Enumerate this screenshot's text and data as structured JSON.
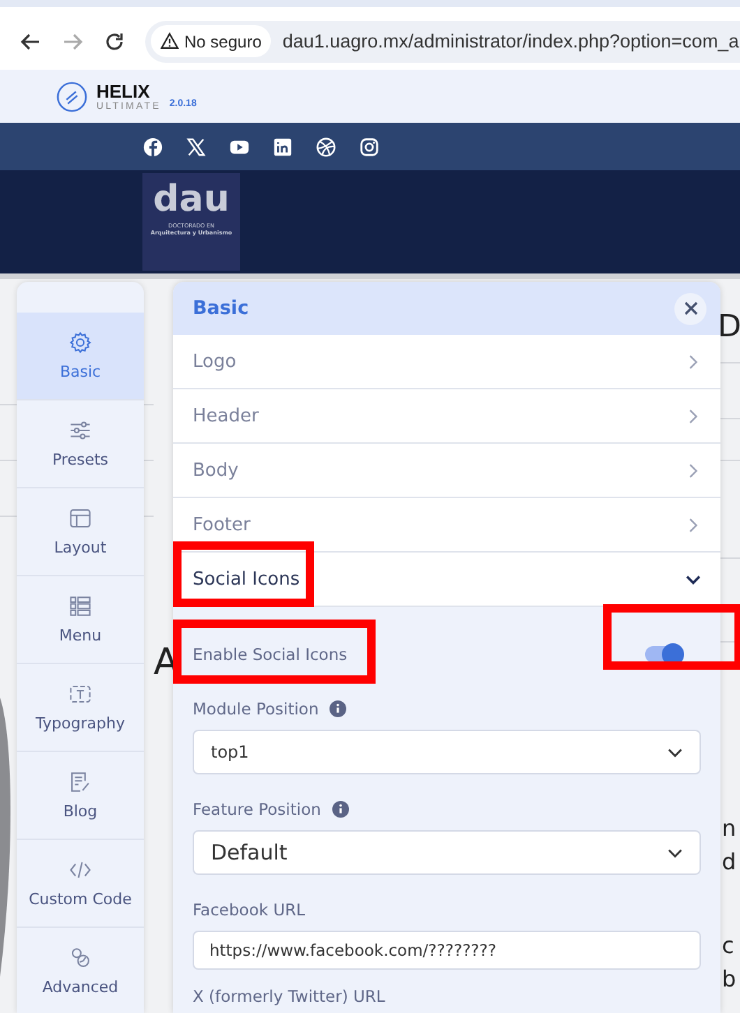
{
  "browser": {
    "security": "No seguro",
    "url": "dau1.uagro.mx/administrator/index.php?option=com_a"
  },
  "helix": {
    "name": "HELIX",
    "subtitle": "ULTIMATE",
    "version": "2.0.18"
  },
  "site_logo": {
    "wordmark": "dau",
    "line_1": "DOCTORADO EN",
    "line_2": "Arquitectura y Urbanismo"
  },
  "background_fragments": [
    "D",
    "A",
    "n",
    "d",
    "c",
    "b"
  ],
  "sidebar": {
    "items": [
      {
        "label": "Basic",
        "kind": "gear",
        "selected": true
      },
      {
        "label": "Presets",
        "kind": "sliders",
        "selected": false
      },
      {
        "label": "Layout",
        "kind": "layout",
        "selected": false
      },
      {
        "label": "Menu",
        "kind": "menu",
        "selected": false
      },
      {
        "label": "Typography",
        "kind": "type",
        "selected": false
      },
      {
        "label": "Blog",
        "kind": "blog",
        "selected": false
      },
      {
        "label": "Custom Code",
        "kind": "code",
        "selected": false
      },
      {
        "label": "Advanced",
        "kind": "advanced",
        "selected": false
      }
    ]
  },
  "panel": {
    "title": "Basic",
    "sections": [
      {
        "label": "Logo",
        "expanded": false
      },
      {
        "label": "Header",
        "expanded": false
      },
      {
        "label": "Body",
        "expanded": false
      },
      {
        "label": "Footer",
        "expanded": false
      },
      {
        "label": "Social Icons",
        "expanded": true
      }
    ],
    "fields": [
      {
        "kind": "toggle",
        "label": "Enable Social Icons",
        "on": true
      },
      {
        "kind": "select",
        "label": "Module Position",
        "info": true,
        "value": "top1"
      },
      {
        "kind": "select_large",
        "label": "Feature Position",
        "info": true,
        "value": "Default"
      },
      {
        "kind": "text",
        "label": "Facebook URL",
        "value": "https://www.facebook.com/????????"
      },
      {
        "kind": "heading",
        "label": "X (formerly Twitter) URL"
      }
    ]
  }
}
